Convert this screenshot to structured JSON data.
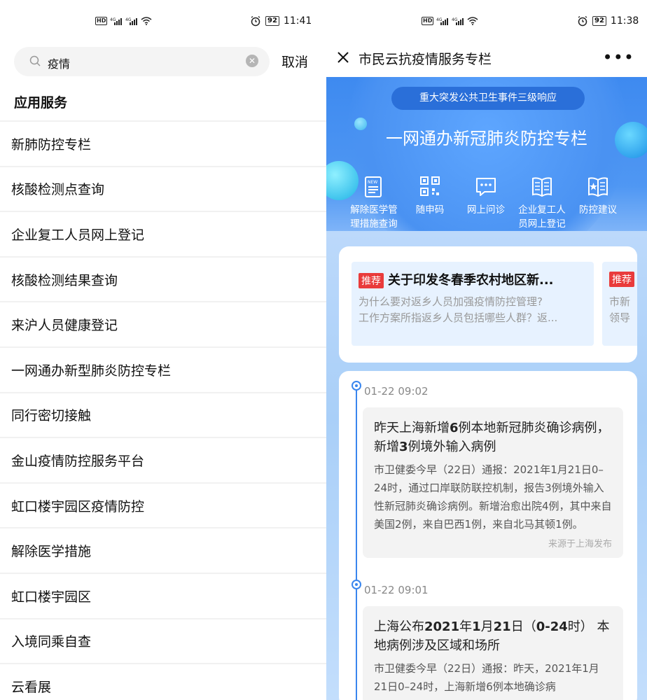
{
  "left": {
    "status": {
      "network": "HD 4G 4G",
      "battery": "92",
      "time": "11:41"
    },
    "search": {
      "query": "疫情",
      "cancel": "取消"
    },
    "section_title": "应用服务",
    "items": [
      "新肺防控专栏",
      "核酸检测点查询",
      "企业复工人员网上登记",
      "核酸检测结果查询",
      "来沪人员健康登记",
      "一网通办新型肺炎防控专栏",
      "同行密切接触",
      "金山疫情防控服务平台",
      "虹口楼宇园区疫情防控",
      "解除医学措施",
      "虹口楼宇园区",
      "入境同乘自查",
      "云看展"
    ]
  },
  "right": {
    "status": {
      "network": "HD 4G 4G",
      "battery": "92",
      "time": "11:38"
    },
    "header": {
      "title": "市民云抗疫情服务专栏"
    },
    "banner": {
      "pill": "重大突发公共卫生事件三级响应",
      "title": "一网通办新冠肺炎防控专栏",
      "quick": [
        {
          "label1": "解除医学管",
          "label2": "理措施查询",
          "icon": "news-icon"
        },
        {
          "label1": "随申码",
          "label2": "",
          "icon": "qr-code-icon"
        },
        {
          "label1": "网上问诊",
          "label2": "",
          "icon": "chat-icon"
        },
        {
          "label1": "企业复工人",
          "label2": "员网上登记",
          "icon": "book-icon"
        },
        {
          "label1": "防控建议",
          "label2": "",
          "icon": "star-book-icon"
        }
      ]
    },
    "recommend": {
      "tag": "推荐",
      "title": "关于印发冬春季农村地区新...",
      "desc1": "为什么要对返乡人员加强疫情防控管理?",
      "desc2": "工作方案所指返乡人员包括哪些人群？返...",
      "next_tag": "推荐",
      "next_desc1": "市新",
      "next_desc2": "领导"
    },
    "timeline": [
      {
        "time": "01-22 09:02",
        "title_html_parts": [
          "昨天上海新增",
          "6",
          "例本地新冠肺炎确诊病例，新增",
          "3",
          "例境外输入病例"
        ],
        "body": "市卫健委今早（22日）通报：2021年1月21日0–24时，通过口岸联防联控机制，报告3例境外输入性新冠肺炎确诊病例。新增治愈出院4例，其中来自美国2例，来自巴西1例，来自北马其顿1例。",
        "source": "来源于上海发布"
      },
      {
        "time": "01-22 09:01",
        "title_html_parts": [
          "上海公布",
          "2021",
          "年",
          "1",
          "月",
          "21",
          "日（",
          "0-24",
          "时） 本地病例涉及区域和场所"
        ],
        "body": "市卫健委今早（22日）通报：昨天，2021年1月21日0–24时，上海新增6例本地确诊病",
        "source": ""
      }
    ]
  }
}
